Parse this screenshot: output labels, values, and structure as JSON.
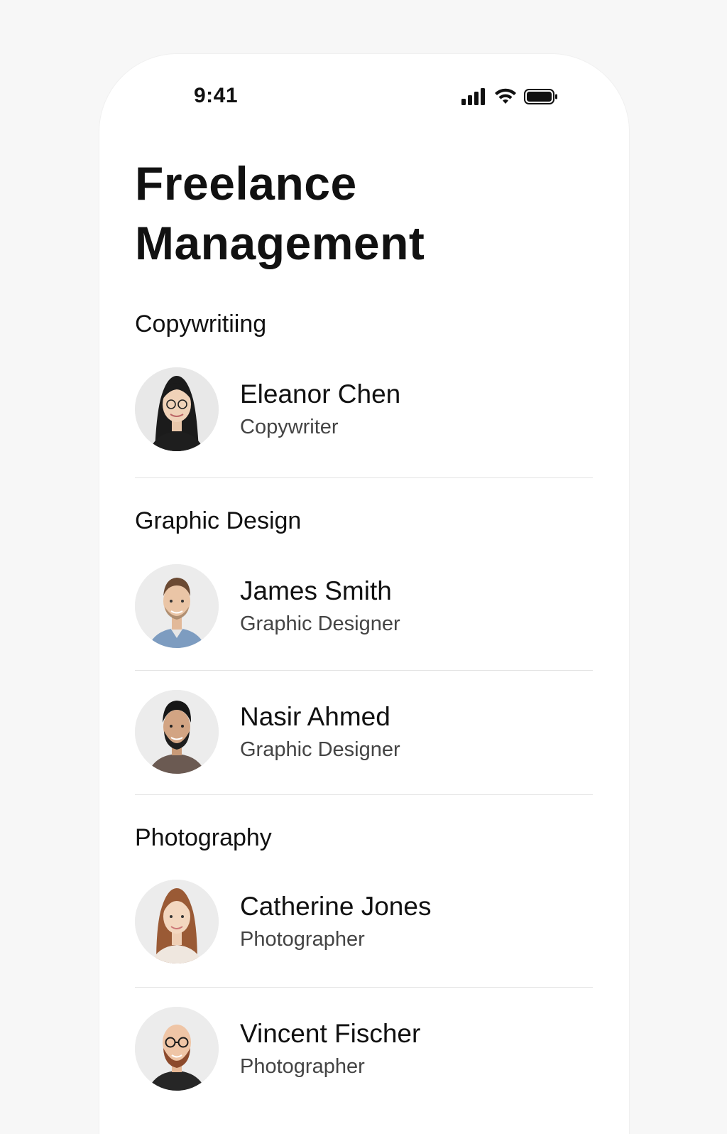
{
  "status_bar": {
    "time": "9:41",
    "icons": [
      "cellular-signal-icon",
      "wifi-icon",
      "battery-icon"
    ]
  },
  "page": {
    "title": "Freelance Management"
  },
  "sections": [
    {
      "title": "Copywritiing",
      "people": [
        {
          "name": "Eleanor Chen",
          "role": "Copywriter"
        }
      ]
    },
    {
      "title": "Graphic Design",
      "people": [
        {
          "name": "James Smith",
          "role": "Graphic Designer"
        },
        {
          "name": "Nasir Ahmed",
          "role": "Graphic Designer"
        }
      ]
    },
    {
      "title": "Photography",
      "people": [
        {
          "name": "Catherine Jones",
          "role": "Photographer"
        },
        {
          "name": "Vincent Fischer",
          "role": "Photographer"
        }
      ]
    }
  ],
  "colors": {
    "background": "#f7f7f7",
    "card": "#ffffff",
    "text_primary": "#111111",
    "text_secondary": "#444444",
    "divider": "#e3e3e3"
  }
}
